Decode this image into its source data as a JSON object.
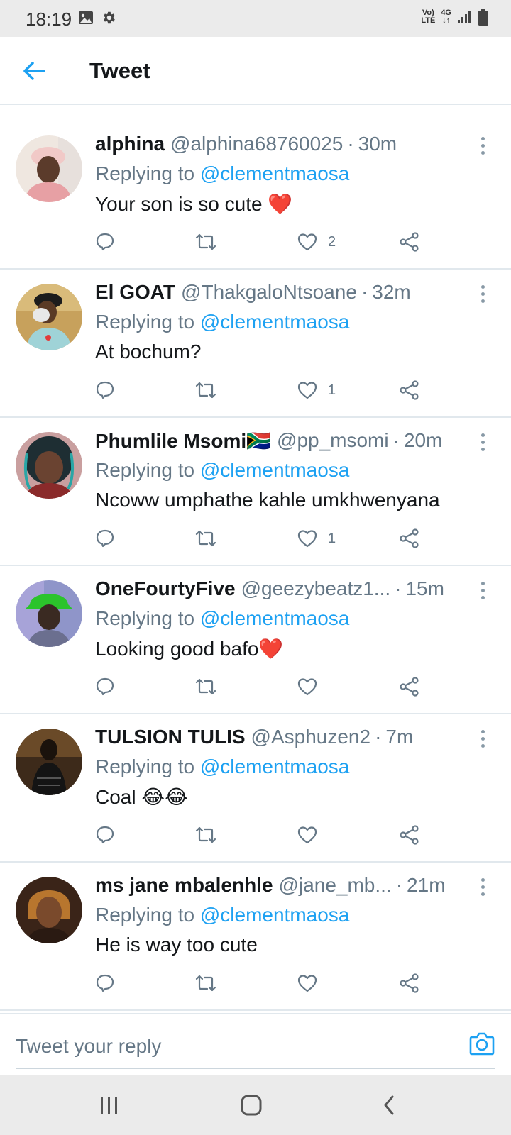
{
  "status_bar": {
    "time": "18:19",
    "volte_line1": "Vo)",
    "volte_line2": "LTE",
    "network_top": "4G",
    "network_bottom": "↓↑",
    "icons": [
      "gallery-icon",
      "settings-gear-icon",
      "signal-icon",
      "battery-icon"
    ]
  },
  "header": {
    "title": "Tweet",
    "back_icon": "arrow-left-icon"
  },
  "accent_color": "#1da1f2",
  "replies": [
    {
      "name": "alphina",
      "handle": "@alphina68760025",
      "separator": "·",
      "time": "30m",
      "replying_prefix": "Replying to ",
      "replying_to": "@clementmaosa",
      "text": "Your son is so cute ❤️",
      "like_count": "2",
      "truncated": false
    },
    {
      "name": "El GOAT",
      "handle": "@ThakgaloNtsoane",
      "separator": "·",
      "time": "32m",
      "replying_prefix": "Replying to ",
      "replying_to": "@clementmaosa",
      "text": "At bochum?",
      "like_count": "1",
      "truncated": false
    },
    {
      "name": "Phumlile Msomi🇿🇦",
      "handle": "@pp_msomi",
      "separator": "·",
      "time": "20m",
      "replying_prefix": "Replying to ",
      "replying_to": "@clementmaosa",
      "text": "Ncoww umphathe kahle umkhwenyana",
      "like_count": "1",
      "truncated": false
    },
    {
      "name": "OneFourtyFive",
      "handle": "@geezybeatz1...",
      "separator": "·",
      "time": "15m",
      "replying_prefix": "Replying to ",
      "replying_to": "@clementmaosa",
      "text": "Looking good bafo❤️",
      "like_count": "",
      "truncated": true
    },
    {
      "name": "TULSION TULIS",
      "handle": "@Asphuzen2",
      "separator": "·",
      "time": "7m",
      "replying_prefix": "Replying to ",
      "replying_to": "@clementmaosa",
      "text": "Coal 😂😂",
      "like_count": "",
      "truncated": false
    },
    {
      "name": "ms jane mbalenhle",
      "handle": "@jane_mb...",
      "separator": "·",
      "time": "21m",
      "replying_prefix": "Replying to ",
      "replying_to": "@clementmaosa",
      "text": "He is way too cute",
      "like_count": "",
      "truncated": true
    }
  ],
  "reply_bar": {
    "placeholder": "Tweet your reply",
    "camera_icon": "camera-icon"
  },
  "nav_bar": {
    "icons": [
      "recent-apps-icon",
      "home-icon",
      "back-icon"
    ]
  }
}
